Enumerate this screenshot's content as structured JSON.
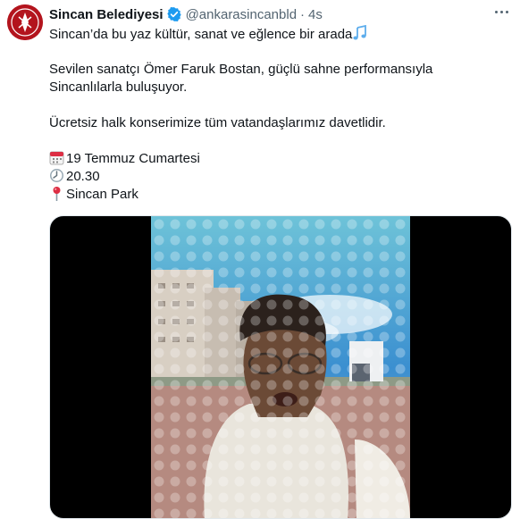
{
  "tweet": {
    "author_name": "Sincan Belediyesi",
    "handle": "@ankarasincanbld",
    "separator": "·",
    "time": "4s",
    "lines": {
      "l1": "Sincan’da bu yaz kültür, sanat ve eğlence bir arada",
      "l2": "Sevilen sanatçı Ömer Faruk Bostan, güçlü sahne performansıyla",
      "l3": "Sincanlılarla buluşuyor.",
      "l4": "Ücretsiz halk konserimize tüm vatandaşlarımız davetlidir.",
      "l5": "19 Temmuz Cumartesi",
      "l6": "20.30",
      "l7": "Sincan Park"
    },
    "icons": [
      "verified-badge-icon",
      "music-notes-icon",
      "calendar-icon",
      "clock-icon",
      "location-pin-icon",
      "more-options-icon"
    ]
  },
  "colors": {
    "brand_red": "#b3141d",
    "verified_blue": "#1d9bf0",
    "text_primary": "#0f1419",
    "text_secondary": "#536471"
  }
}
